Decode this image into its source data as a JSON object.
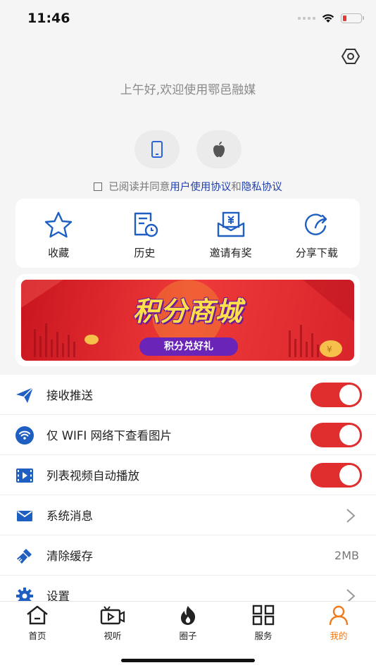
{
  "status_bar": {
    "time": "11:46"
  },
  "greeting": "上午好,欢迎使用鄂邑融媒",
  "agreement": {
    "prefix": "已阅读并同意",
    "user_agreement": "用户使用协议",
    "conjunction": "和",
    "privacy_policy": "隐私协议"
  },
  "quick_actions": [
    {
      "label": "收藏",
      "icon": "star-icon"
    },
    {
      "label": "历史",
      "icon": "history-icon"
    },
    {
      "label": "邀请有奖",
      "icon": "invite-reward-icon"
    },
    {
      "label": "分享下载",
      "icon": "share-download-icon"
    }
  ],
  "banner": {
    "title": "积分商城",
    "subtitle": "积分兑好礼"
  },
  "settings": [
    {
      "label": "接收推送",
      "icon": "send-icon",
      "control": "toggle",
      "on": true
    },
    {
      "label": "仅 WIFI 网络下查看图片",
      "icon": "wifi-icon",
      "control": "toggle",
      "on": true
    },
    {
      "label": "列表视频自动播放",
      "icon": "video-icon",
      "control": "toggle",
      "on": true
    },
    {
      "label": "系统消息",
      "icon": "mail-icon",
      "control": "chevron"
    },
    {
      "label": "清除缓存",
      "icon": "broom-icon",
      "control": "value",
      "value": "2MB"
    },
    {
      "label": "设置",
      "icon": "gear-icon",
      "control": "chevron"
    }
  ],
  "tabs": [
    {
      "label": "首页",
      "icon": "home-icon",
      "active": false
    },
    {
      "label": "视听",
      "icon": "video-camera-icon",
      "active": false
    },
    {
      "label": "圈子",
      "icon": "flame-icon",
      "active": false
    },
    {
      "label": "服务",
      "icon": "grid-icon",
      "active": false
    },
    {
      "label": "我的",
      "icon": "user-icon",
      "active": true
    }
  ],
  "colors": {
    "accent_blue": "#1f5fc2",
    "link_blue": "#1f3fae",
    "toggle_red": "#e02e2e",
    "active_tab_orange": "#f07b1e",
    "battery_low_red": "#e53935"
  },
  "battery_level": 0.2
}
